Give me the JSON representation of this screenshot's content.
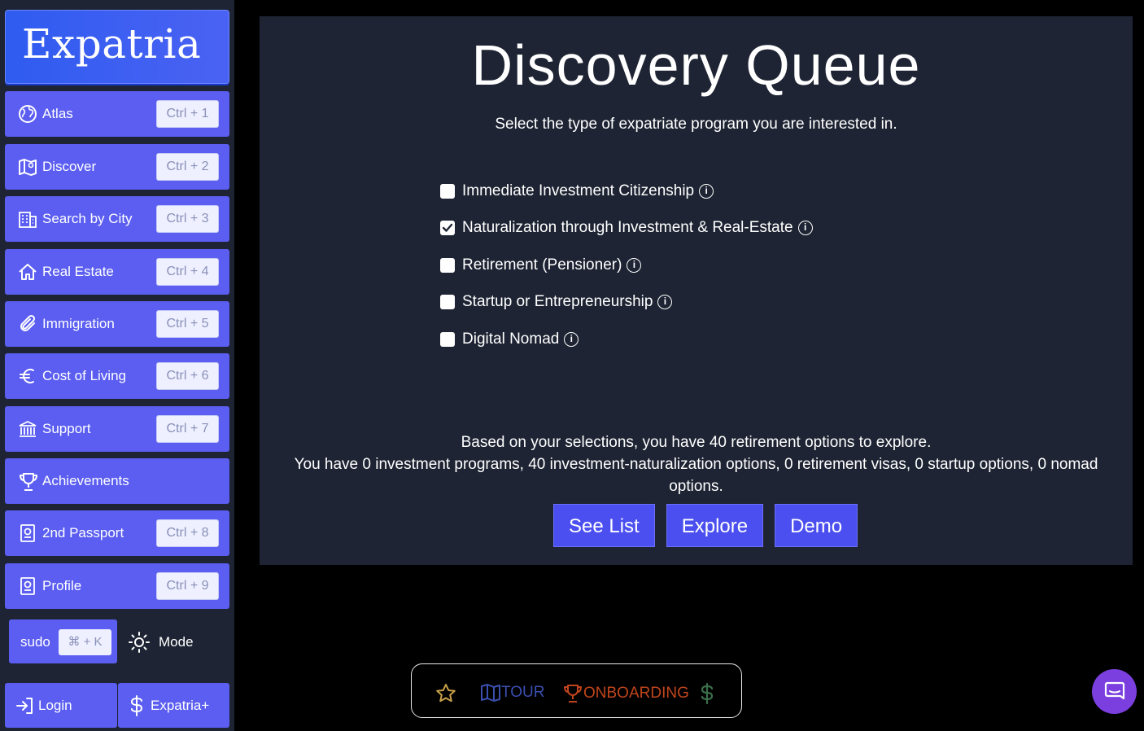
{
  "brand": "Expatria",
  "nav": [
    {
      "label": "Atlas",
      "shortcut": "Ctrl + 1",
      "icon": "globe-icon"
    },
    {
      "label": "Discover",
      "shortcut": "Ctrl + 2",
      "icon": "map-pin-icon"
    },
    {
      "label": "Search by City",
      "shortcut": "Ctrl + 3",
      "icon": "building-icon"
    },
    {
      "label": "Real Estate",
      "shortcut": "Ctrl + 4",
      "icon": "home-icon"
    },
    {
      "label": "Immigration",
      "shortcut": "Ctrl + 5",
      "icon": "paperclip-icon"
    },
    {
      "label": "Cost of Living",
      "shortcut": "Ctrl + 6",
      "icon": "euro-icon"
    },
    {
      "label": "Support",
      "shortcut": "Ctrl + 7",
      "icon": "bank-icon"
    },
    {
      "label": "Achievements",
      "shortcut": "",
      "icon": "trophy-icon"
    },
    {
      "label": "2nd Passport",
      "shortcut": "Ctrl + 8",
      "icon": "passport-icon"
    },
    {
      "label": "Profile",
      "shortcut": "Ctrl + 9",
      "icon": "profile-icon"
    }
  ],
  "sudo": {
    "label": "sudo",
    "shortcut": "⌘ + K"
  },
  "mode": {
    "label": "Mode"
  },
  "login": {
    "label": "Login"
  },
  "plus": {
    "label": "Expatria+"
  },
  "main": {
    "title": "Discovery Queue",
    "subtitle": "Select the type of expatriate program you are interested in.",
    "options": [
      {
        "label": "Immediate Investment Citizenship",
        "checked": false
      },
      {
        "label": "Naturalization through Investment & Real-Estate",
        "checked": true
      },
      {
        "label": "Retirement (Pensioner)",
        "checked": false
      },
      {
        "label": "Startup or Entrepreneurship",
        "checked": false
      },
      {
        "label": "Digital Nomad",
        "checked": false
      }
    ],
    "summary_line1": "Based on your selections, you have 40 retirement options to explore.",
    "summary_line2": "You have 0 investment programs, 40 investment-naturalization options, 0 retirement visas, 0 startup options, 0 nomad options.",
    "buttons": [
      "See List",
      "Explore",
      "Demo"
    ]
  },
  "tourbar": {
    "tour": "TOUR",
    "onboarding": "ONBOARDING"
  },
  "colors": {
    "accent": "#5b5ef0",
    "panel": "#1e2433",
    "tour": "#3b4fb0",
    "onboarding": "#c0451c",
    "dollar": "#3a6f4a",
    "star": "#c9a24a",
    "chat": "#7b3fe0"
  }
}
